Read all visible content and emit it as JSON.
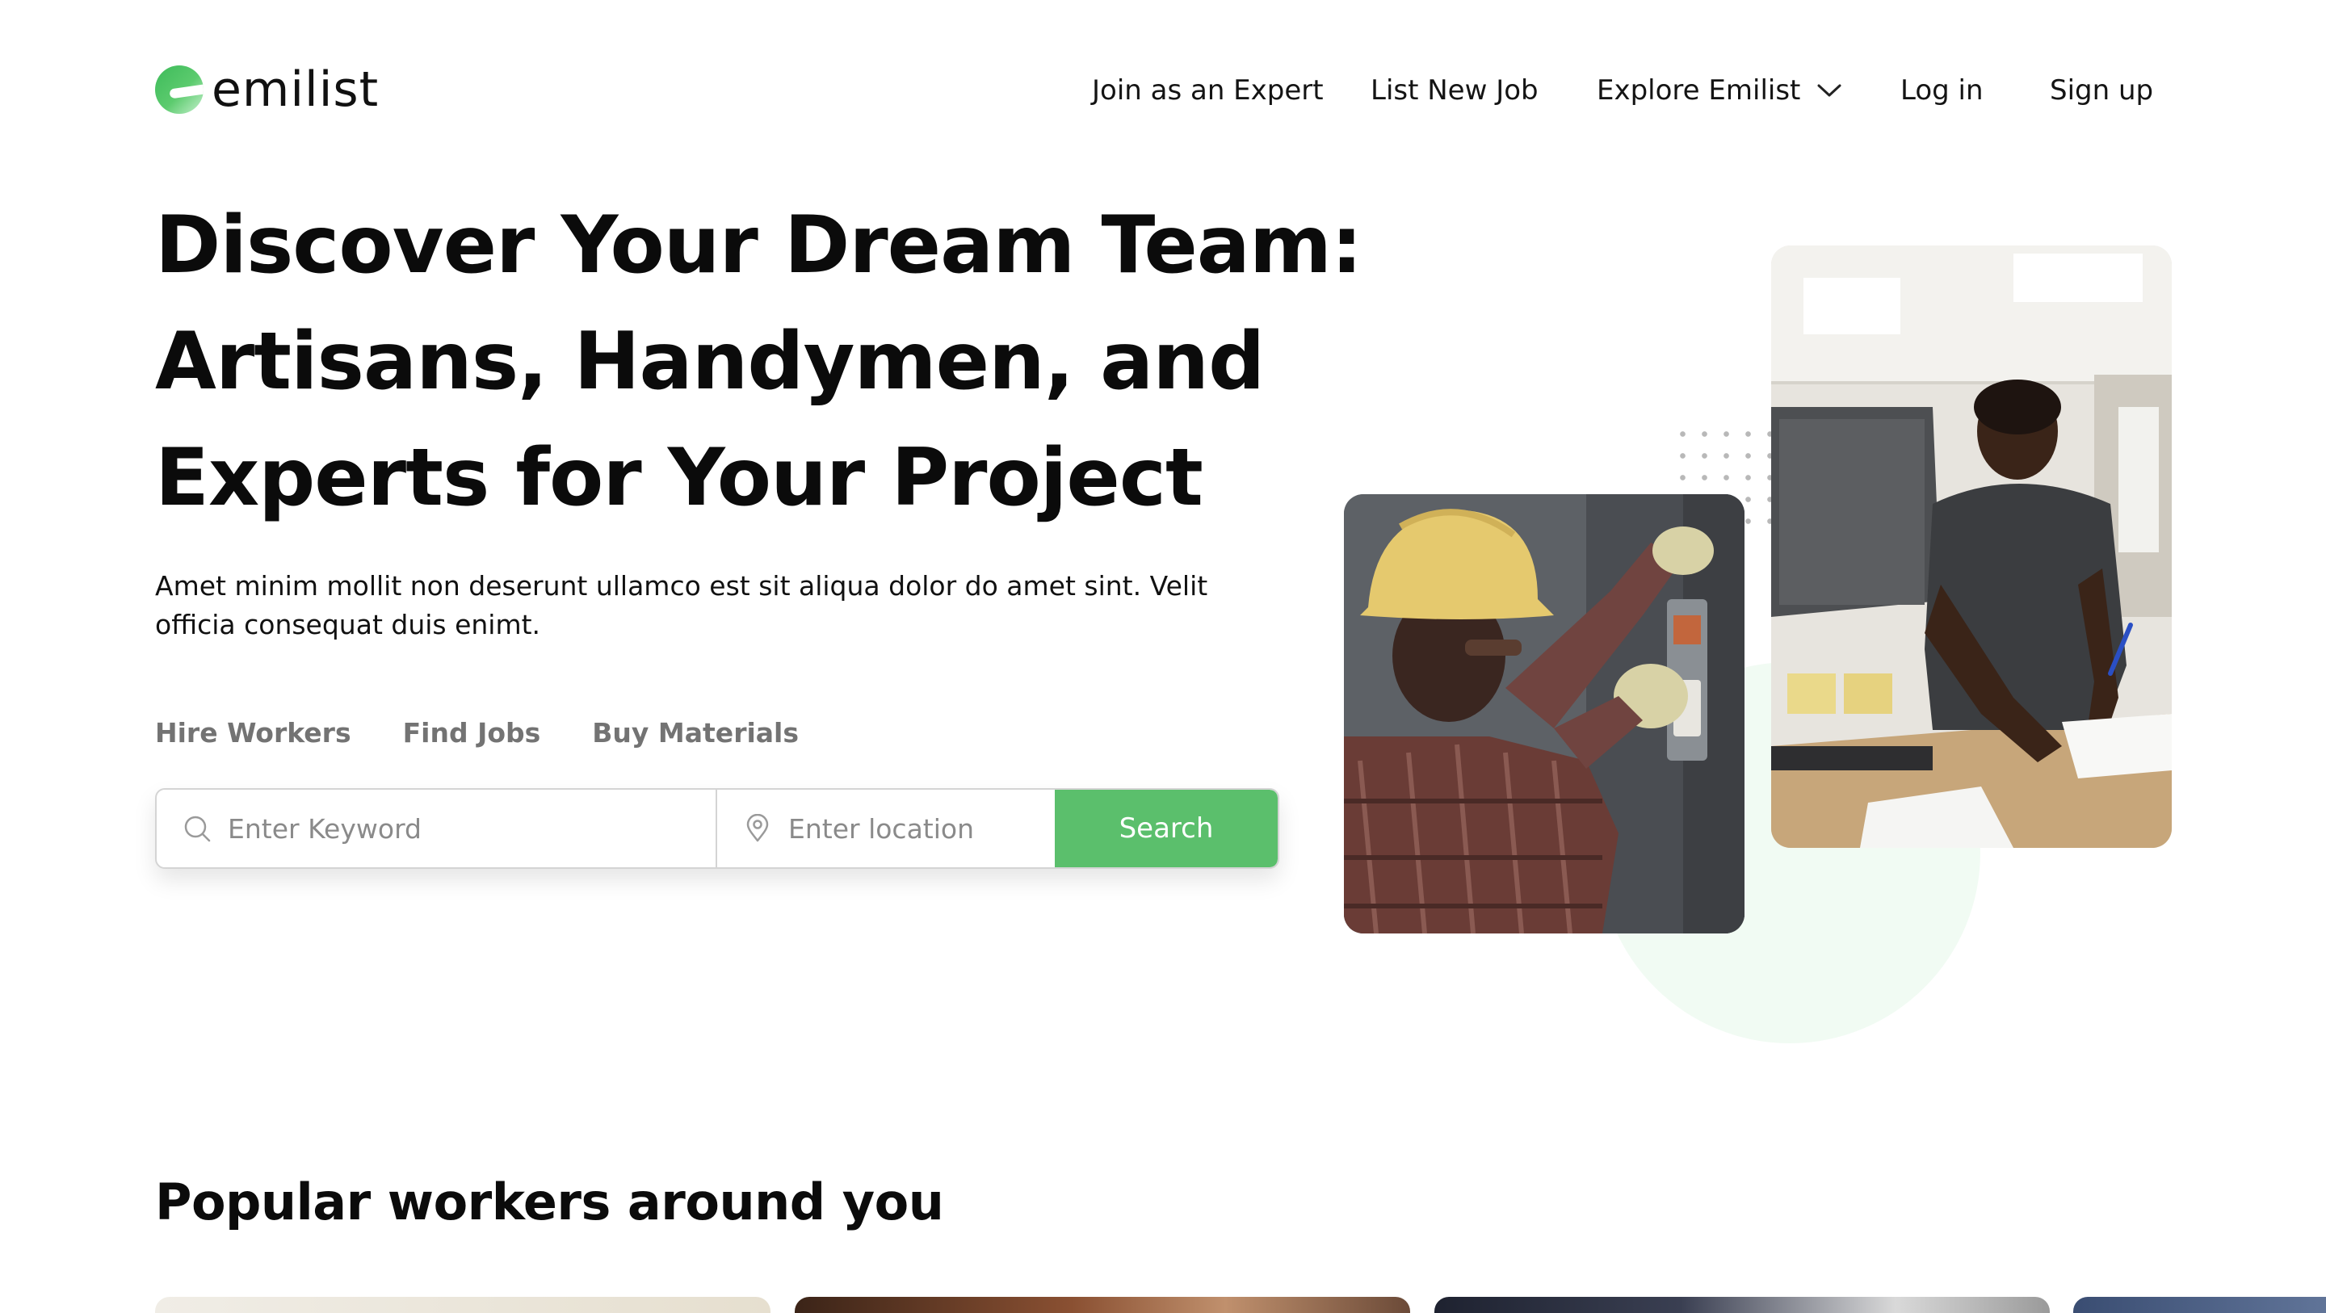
{
  "brand": {
    "name": "emilist",
    "accent_color": "#5bbf6c"
  },
  "nav": {
    "join_expert": "Join as an Expert",
    "list_job": "List New Job",
    "explore": "Explore Emilist",
    "login": "Log in",
    "signup": "Sign up"
  },
  "hero": {
    "title_line1": "Discover Your Dream Team:",
    "title_line2": "Artisans, Handymen, and",
    "title_line3": "Experts for Your Project",
    "description": "Amet minim mollit non deserunt ullamco est sit aliqua dolor do amet sint. Velit officia consequat duis enimt."
  },
  "tabs": [
    "Hire Workers",
    "Find Jobs",
    "Buy Materials"
  ],
  "search": {
    "keyword_placeholder": "Enter Keyword",
    "location_placeholder": "Enter location",
    "button_label": "Search"
  },
  "icons": {
    "logo": "emilist-logo-icon",
    "dropdown": "chevron-down-icon",
    "keyword": "search-icon",
    "location": "location-pin-icon"
  },
  "popular": {
    "title": "Popular workers around you"
  }
}
